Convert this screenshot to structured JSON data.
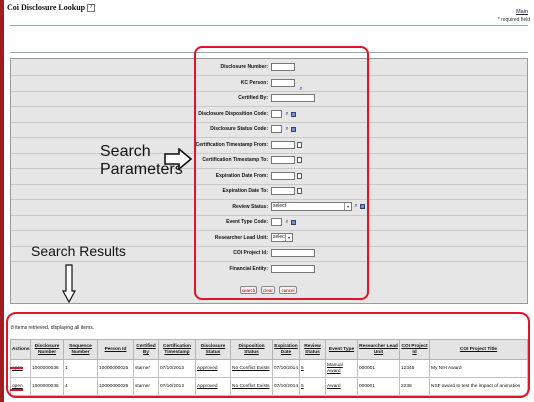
{
  "header": {
    "title": "Coi Disclosure Lookup",
    "help_glyph": "?",
    "main_link": "Main",
    "required_note": "* required field"
  },
  "form": {
    "fields": [
      {
        "label": "Disclosure Number:",
        "kind": "text"
      },
      {
        "label": "KC Person:",
        "kind": "text-lookup"
      },
      {
        "label": "Certified By:",
        "kind": "text"
      },
      {
        "label": "Disclosure Disposition Code:",
        "kind": "lookup"
      },
      {
        "label": "Disclosure Status Code:",
        "kind": "lookup"
      },
      {
        "label": "Certification Timestamp From:",
        "kind": "date"
      },
      {
        "label": "Certification Timestamp To:",
        "kind": "date"
      },
      {
        "label": "Expiration Date From:",
        "kind": "date"
      },
      {
        "label": "Expiration Date To:",
        "kind": "date"
      },
      {
        "label": "Review Status:",
        "kind": "select",
        "value": "select"
      },
      {
        "label": "Event Type Code:",
        "kind": "lookup"
      },
      {
        "label": "Researcher Lead Unit:",
        "kind": "select",
        "value": "select"
      },
      {
        "label": "COI Project Id:",
        "kind": "text"
      },
      {
        "label": "Financial Entity:",
        "kind": "text"
      }
    ],
    "buttons": {
      "search": "search",
      "clear": "clear",
      "cancel": "cancel"
    }
  },
  "annotations": {
    "search_params_line1": "Search",
    "search_params_line2": "Parameters",
    "search_results": "Search Results",
    "annotation_color": "#e0142a"
  },
  "results": {
    "message": "8 items retrieved, displaying all items.",
    "columns": [
      "Actions",
      "Disclosure Number",
      "Sequence Number",
      "Person Id",
      "Certified By",
      "Certification Timestamp",
      "Disclosure Status",
      "Disposition Status",
      "Expiration Date",
      "Review Status",
      "Event Type",
      "Researcher Lead Unit",
      "COI Project Id",
      "COI Project Title"
    ],
    "rows": [
      [
        "open",
        "1000000036",
        "1",
        "10000000025",
        "starner",
        "07/10/2013",
        "Approved",
        "No Conflict Exists",
        "07/10/2014",
        "5",
        "Manual Award",
        "000001",
        "12345",
        "My NIH Award"
      ],
      [
        "open",
        "1000000036",
        "4",
        "10000000025",
        "starner",
        "07/10/2013",
        "Approved",
        "No Conflict Exists",
        "07/10/2014",
        "5",
        "Award",
        "000001",
        "2238",
        "NSF award to test the impact of animation"
      ]
    ]
  },
  "icons": {
    "lookup": "magnifier-icon",
    "direct_inquiry": "direct-inquiry-icon",
    "calendar": "calendar-icon"
  }
}
